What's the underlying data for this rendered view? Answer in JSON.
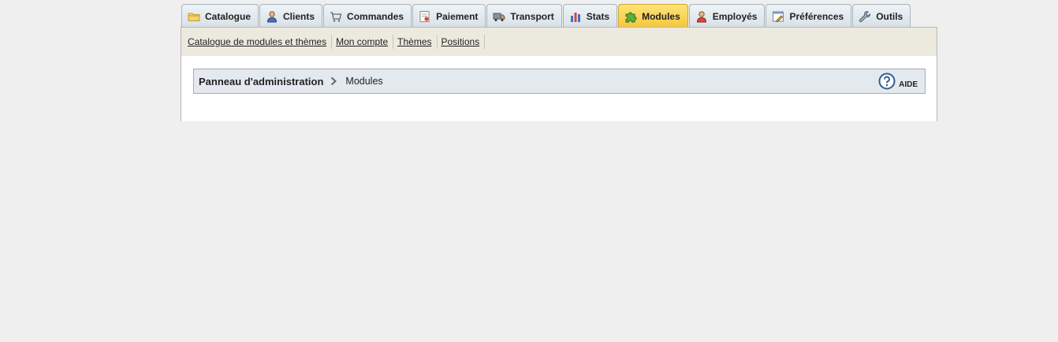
{
  "tabs": [
    {
      "label": "Catalogue",
      "icon": "folder-icon"
    },
    {
      "label": "Clients",
      "icon": "user-icon"
    },
    {
      "label": "Commandes",
      "icon": "cart-icon"
    },
    {
      "label": "Paiement",
      "icon": "invoice-icon"
    },
    {
      "label": "Transport",
      "icon": "truck-icon"
    },
    {
      "label": "Stats",
      "icon": "bar-chart-icon"
    },
    {
      "label": "Modules",
      "icon": "puzzle-icon",
      "active": true
    },
    {
      "label": "Employés",
      "icon": "employee-icon"
    },
    {
      "label": "Préférences",
      "icon": "preferences-icon"
    },
    {
      "label": "Outils",
      "icon": "wrench-icon"
    }
  ],
  "subnav": [
    "Catalogue de modules et thèmes",
    "Mon compte",
    "Thèmes",
    "Positions"
  ],
  "breadcrumb": {
    "root": "Panneau d'administration",
    "current": "Modules"
  },
  "help": {
    "label": "AIDE"
  },
  "colors": {
    "active_tab": "#f6c63a",
    "tab": "#d8e1e7",
    "subbar": "#ece9df",
    "breadcrumb_bg": "#e3e9ee",
    "page_bg": "#efefef"
  }
}
